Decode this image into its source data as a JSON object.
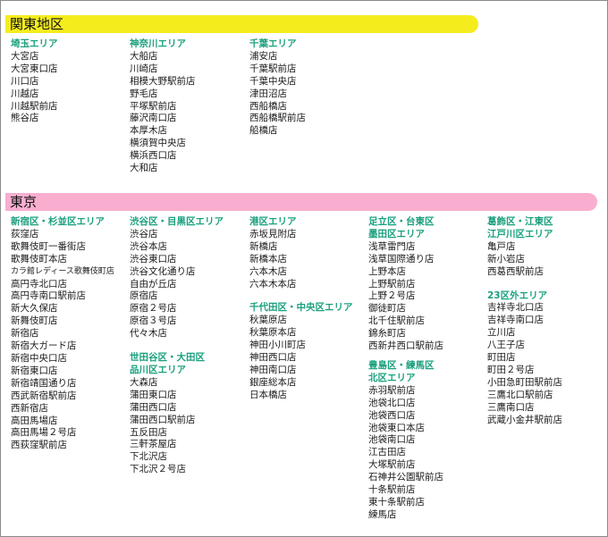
{
  "colors": {
    "kanto_bar": "#f5ec1e",
    "tokyo_bar": "#f9aed0",
    "heading": "#1aa07e"
  },
  "kanto": {
    "title": "関東地区",
    "columns": [
      {
        "groups": [
          {
            "heading": [
              "埼玉エリア"
            ],
            "stores": [
              "大宮店",
              "大宮東口店",
              "川口店",
              "川越店",
              "川越駅前店",
              "熊谷店"
            ]
          }
        ]
      },
      {
        "groups": [
          {
            "heading": [
              "神奈川エリア"
            ],
            "stores": [
              "大船店",
              "川崎店",
              "相模大野駅前店",
              "野毛店",
              "平塚駅前店",
              "藤沢南口店",
              "本厚木店",
              "横須賀中央店",
              "横浜西口店",
              "大和店"
            ]
          }
        ]
      },
      {
        "groups": [
          {
            "heading": [
              "千葉エリア"
            ],
            "stores": [
              "浦安店",
              "千葉駅前店",
              "千葉中央店",
              "津田沼店",
              "西船橋店",
              "西船橋駅前店",
              "船橋店"
            ]
          }
        ]
      }
    ]
  },
  "tokyo": {
    "title": "東京",
    "columns": [
      {
        "groups": [
          {
            "heading": [
              "新宿区・杉並区エリア"
            ],
            "stores": [
              "荻窪店",
              "歌舞伎町一番街店",
              "歌舞伎町本店",
              "カラ館レディース歌舞伎町店",
              "高円寺北口店",
              "高円寺南口駅前店",
              "新大久保店",
              "新舞伎町店",
              "新宿店",
              "新宿大ガード店",
              "新宿中央口店",
              "新宿東口店",
              "新宿靖国通り店",
              "西武新宿駅前店",
              "西新宿店",
              "高田馬場店",
              "高田馬場２号店",
              "西荻窪駅前店"
            ]
          }
        ]
      },
      {
        "groups": [
          {
            "heading": [
              "渋谷区・目黒区エリア"
            ],
            "stores": [
              "渋谷店",
              "渋谷本店",
              "渋谷東口店",
              "渋谷文化通り店",
              "自由が丘店",
              "原宿店",
              "原宿２号店",
              "原宿３号店",
              "代々木店"
            ]
          },
          {
            "heading": [
              "世田谷区・大田区",
              "品川区エリア"
            ],
            "stores": [
              "大森店",
              "蒲田東口店",
              "蒲田西口店",
              "蒲田西口駅前店",
              "五反田店",
              "三軒茶屋店",
              "下北沢店",
              "下北沢２号店"
            ]
          }
        ]
      },
      {
        "groups": [
          {
            "heading": [
              "港区エリア"
            ],
            "stores": [
              "赤坂見附店",
              "新橋店",
              "新橋本店",
              "六本木店",
              "六本木本店"
            ]
          },
          {
            "heading": [
              "千代田区・中央区エリア"
            ],
            "stores": [
              "秋葉原店",
              "秋葉原本店",
              "神田小川町店",
              "神田西口店",
              "神田南口店",
              "銀座総本店",
              "日本橋店"
            ]
          }
        ]
      },
      {
        "groups": [
          {
            "heading": [
              "足立区・台東区",
              "墨田区エリア"
            ],
            "stores": [
              "浅草雷門店",
              "浅草国際通り店",
              "上野本店",
              "上野駅前店",
              "上野２号店",
              "御徒町店",
              "北千住駅前店",
              "錦糸町店",
              "西新井西口駅前店"
            ]
          },
          {
            "heading": [
              "豊島区・練馬区",
              "北区エリア"
            ],
            "stores": [
              "赤羽駅前店",
              "池袋北口店",
              "池袋西口店",
              "池袋東口本店",
              "池袋南口店",
              "江古田店",
              "大塚駅前店",
              "石神井公園駅前店",
              "十条駅前店",
              "東十条駅前店",
              "練馬店"
            ]
          }
        ]
      },
      {
        "groups": [
          {
            "heading": [
              "葛飾区・江東区",
              "江戸川区エリア"
            ],
            "stores": [
              "亀戸店",
              "新小岩店",
              "西葛西駅前店"
            ]
          },
          {
            "heading": [
              "23区外エリア"
            ],
            "stores": [
              "吉祥寺北口店",
              "吉祥寺南口店",
              "立川店",
              "八王子店",
              "町田店",
              "町田２号店",
              "小田急町田駅前店",
              "三鷹北口駅前店",
              "三鷹南口店",
              "武蔵小金井駅前店"
            ]
          }
        ]
      }
    ]
  }
}
